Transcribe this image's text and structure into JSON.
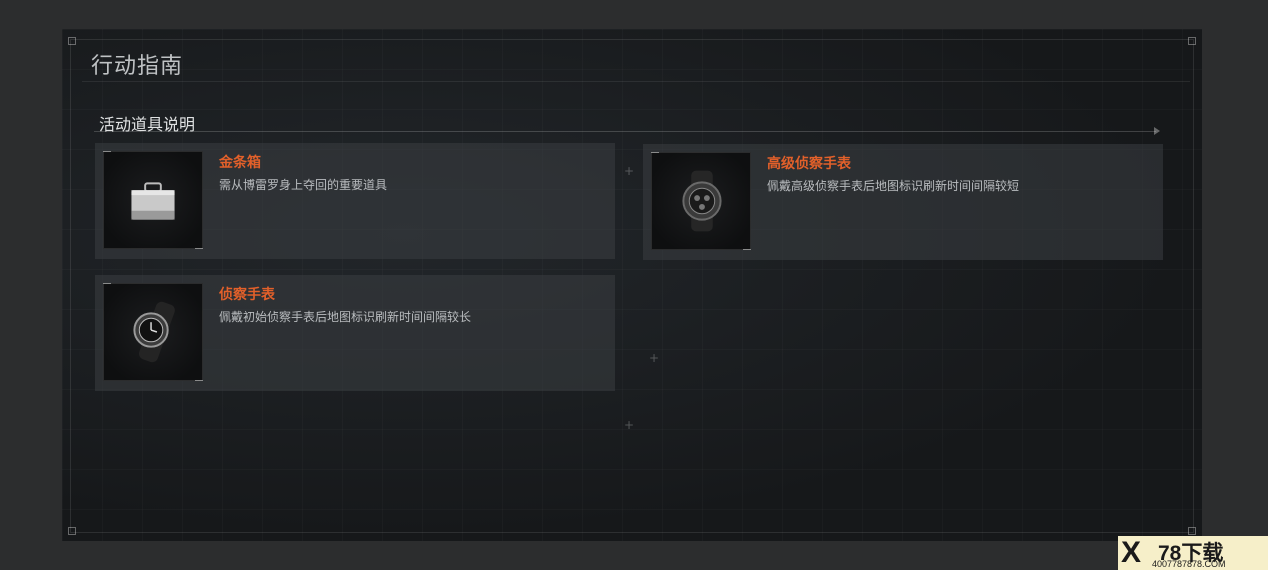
{
  "header": {
    "title": "行动指南",
    "section_title": "活动道具说明"
  },
  "items": [
    {
      "name": "金条箱",
      "description": "需从博雷罗身上夺回的重要道具",
      "icon": "briefcase-icon"
    },
    {
      "name": "高级侦察手表",
      "description": "佩戴高级侦察手表后地图标识刷新时间间隔较短",
      "icon": "advanced-watch-icon"
    },
    {
      "name": "侦察手表",
      "description": "佩戴初始侦察手表后地图标识刷新时间间隔较长",
      "icon": "watch-icon"
    }
  ],
  "watermark": {
    "logo": "X",
    "main": "78下载",
    "url": "4007787878.COM"
  },
  "colors": {
    "accent": "#e2602a",
    "panel_bg": "#17191b",
    "card_bg": "#2f3235"
  }
}
